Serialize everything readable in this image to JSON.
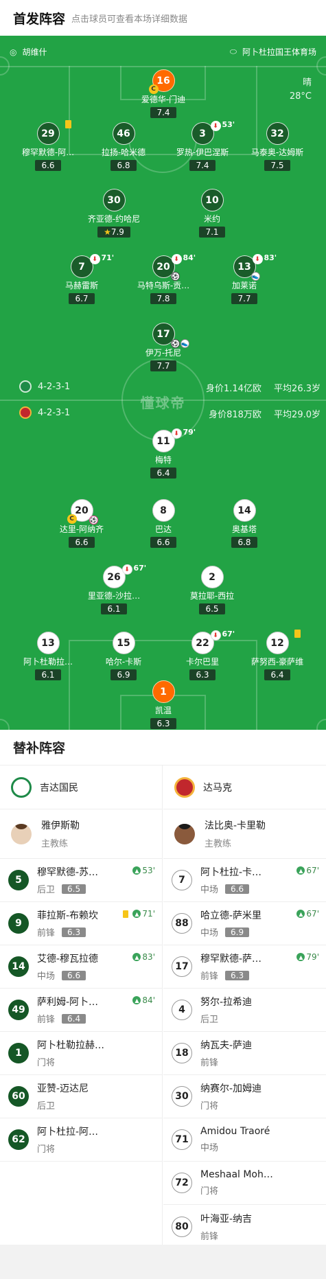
{
  "header": {
    "title": "首发阵容",
    "subtitle": "点击球员可查看本场详细数据"
  },
  "match": {
    "coach_icon": "whistle-icon",
    "referee": "胡维什",
    "stadium_icon": "stadium-icon",
    "stadium": "阿卜杜拉国王体育场",
    "weather": "晴",
    "temperature": "28°C",
    "watermark": "懂球帝"
  },
  "home_form": {
    "formation": "4-2-3-1",
    "value": "身价1.14亿欧",
    "age": "平均26.3岁"
  },
  "away_form": {
    "formation": "4-2-3-1",
    "value": "身价818万欧",
    "age": "平均29.0岁"
  },
  "home_players": [
    {
      "num": "16",
      "name": "爱德华-门迪",
      "rating": "7.4"
    },
    {
      "num": "29",
      "name": "穆罕默德-阿…",
      "rating": "6.6"
    },
    {
      "num": "46",
      "name": "拉扬-哈米德",
      "rating": "6.8"
    },
    {
      "num": "3",
      "name": "罗热-伊巴涅斯",
      "rating": "7.4",
      "min": "53'"
    },
    {
      "num": "32",
      "name": "马泰奥-达姆斯",
      "rating": "7.5"
    },
    {
      "num": "30",
      "name": "齐亚德-约哈尼",
      "rating": "7.9"
    },
    {
      "num": "10",
      "name": "米约",
      "rating": "7.1"
    },
    {
      "num": "7",
      "name": "马赫雷斯",
      "rating": "6.7",
      "min": "71'"
    },
    {
      "num": "20",
      "name": "马特乌斯-贡…",
      "rating": "7.8",
      "min": "84'"
    },
    {
      "num": "13",
      "name": "加莱诺",
      "rating": "7.7",
      "min": "83'"
    },
    {
      "num": "17",
      "name": "伊万-托尼",
      "rating": "7.7"
    }
  ],
  "away_players": [
    {
      "num": "11",
      "name": "梅特",
      "rating": "6.4",
      "min": "79'"
    },
    {
      "num": "20",
      "name": "达里-阿纳齐",
      "rating": "6.6"
    },
    {
      "num": "8",
      "name": "巴达",
      "rating": "6.6"
    },
    {
      "num": "14",
      "name": "奥基塔",
      "rating": "6.8"
    },
    {
      "num": "26",
      "name": "里亚德-沙拉…",
      "rating": "6.1",
      "min": "67'"
    },
    {
      "num": "2",
      "name": "莫拉耶-西拉",
      "rating": "6.5"
    },
    {
      "num": "13",
      "name": "阿卜杜勒拉…",
      "rating": "6.1"
    },
    {
      "num": "15",
      "name": "哈尔-卡斯",
      "rating": "6.9"
    },
    {
      "num": "22",
      "name": "卡尔巴里",
      "rating": "6.3",
      "min": "67'"
    },
    {
      "num": "12",
      "name": "萨努西-豪萨维",
      "rating": "6.4"
    },
    {
      "num": "1",
      "name": "凯温",
      "rating": "6.3"
    }
  ],
  "subs_title": "替补阵容",
  "home_subs": {
    "team": "吉达国民",
    "coach": {
      "name": "雅伊斯勒",
      "role": "主教练"
    },
    "players": [
      {
        "num": "5",
        "name": "穆罕默德-苏…",
        "pos": "后卫",
        "rating": "6.5",
        "min": "53'"
      },
      {
        "num": "9",
        "name": "菲拉斯-布赖坎",
        "pos": "前锋",
        "rating": "6.3",
        "min": "71'"
      },
      {
        "num": "14",
        "name": "艾德-穆瓦拉德",
        "pos": "中场",
        "rating": "6.6",
        "min": "83'"
      },
      {
        "num": "49",
        "name": "萨利姆-阿卜…",
        "pos": "前锋",
        "rating": "6.4",
        "min": "84'"
      },
      {
        "num": "1",
        "name": "阿卜杜勒拉赫…",
        "pos": "门将"
      },
      {
        "num": "60",
        "name": "亚赞-迈达尼",
        "pos": "后卫"
      },
      {
        "num": "62",
        "name": "阿卜杜拉-阿…",
        "pos": "门将"
      }
    ]
  },
  "away_subs": {
    "team": "达马克",
    "coach": {
      "name": "法比奥-卡里勒",
      "role": "主教练"
    },
    "players": [
      {
        "num": "7",
        "name": "阿卜杜拉-卡…",
        "pos": "中场",
        "rating": "6.6",
        "min": "67'"
      },
      {
        "num": "88",
        "name": "哈立德-萨米里",
        "pos": "中场",
        "rating": "6.9",
        "min": "67'"
      },
      {
        "num": "17",
        "name": "穆罕默德-萨…",
        "pos": "前锋",
        "rating": "6.3",
        "min": "79'"
      },
      {
        "num": "4",
        "name": "努尔-拉希迪",
        "pos": "后卫"
      },
      {
        "num": "18",
        "name": "纳瓦夫-萨迪",
        "pos": "前锋"
      },
      {
        "num": "30",
        "name": "纳赛尔-加姆迪",
        "pos": "门将"
      },
      {
        "num": "71",
        "name": "Amidou Traoré",
        "pos": "中场"
      },
      {
        "num": "72",
        "name": "Meshaal Moh…",
        "pos": "门将"
      },
      {
        "num": "80",
        "name": "叶海亚-纳吉",
        "pos": "前锋"
      }
    ]
  }
}
